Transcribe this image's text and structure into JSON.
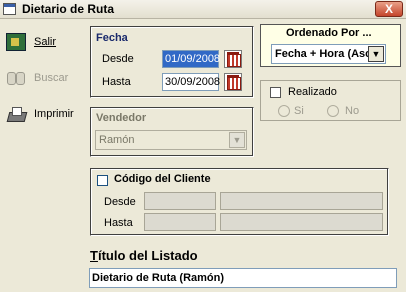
{
  "window": {
    "title": "Dietario de Ruta",
    "close_label": "X"
  },
  "toolbar": {
    "salir": "Salir",
    "buscar": "Buscar",
    "imprimir": "Imprimir"
  },
  "fecha": {
    "label": "Fecha",
    "desde_label": "Desde",
    "desde_value": "01/09/2008",
    "hasta_label": "Hasta",
    "hasta_value": "30/09/2008"
  },
  "ordenado": {
    "label": "Ordenado Por ...",
    "value": "Fecha + Hora (Asc"
  },
  "realizado": {
    "label": "Realizado",
    "si": "Si",
    "no": "No"
  },
  "vendedor": {
    "label": "Vendedor",
    "value": "Ramón"
  },
  "cliente": {
    "label": "Código del Cliente",
    "desde_label": "Desde",
    "hasta_label": "Hasta"
  },
  "titulo": {
    "label_first": "T",
    "label_rest": "ítulo del Listado",
    "value": "Dietario de Ruta (Ramón)"
  }
}
